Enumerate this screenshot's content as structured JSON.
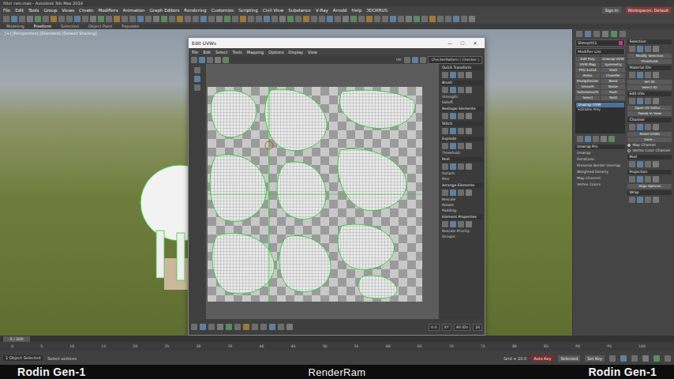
{
  "app": {
    "title": "filter ram.max - Autodesk 3ds Max 2024",
    "menus": [
      "File",
      "Edit",
      "Tools",
      "Group",
      "Views",
      "Create",
      "Modifiers",
      "Animation",
      "Graph Editors",
      "Rendering",
      "Customize",
      "Scripting",
      "Civil View",
      "Substance",
      "V-Ray",
      "Arnold",
      "Help",
      "3DOXRUS"
    ],
    "sign_in": "Sign In",
    "workspace": "Workspaces: Default",
    "ribbon_tabs": [
      {
        "label": "Modeling",
        "selected": false
      },
      {
        "label": "Freeform",
        "selected": true
      },
      {
        "label": "Selection",
        "selected": false
      },
      {
        "label": "Object Paint",
        "selected": false
      },
      {
        "label": "Populate",
        "selected": false
      }
    ]
  },
  "viewport": {
    "label": "[+] [Perspective] [Standard] [Default Shading]"
  },
  "uv_editor": {
    "title": "Edit UVWs",
    "window_buttons": [
      "—",
      "☐",
      "✕"
    ],
    "menus": [
      "File",
      "Edit",
      "Select",
      "Tools",
      "Mapping",
      "Options",
      "Display",
      "View"
    ],
    "uv_mode": "UV",
    "texture": "CheckerPattern ( Checker )",
    "sections": [
      {
        "title": "Quick Transform",
        "items": []
      },
      {
        "title": "Brush",
        "items": [
          "Strength:",
          "Falloff:"
        ]
      },
      {
        "title": "Reshape Elements",
        "items": []
      },
      {
        "title": "Stitch",
        "items": []
      },
      {
        "title": "Explode",
        "items": [
          "Threshold:"
        ]
      },
      {
        "title": "Peel",
        "items": [
          "Detach",
          "Pins"
        ]
      },
      {
        "title": "Arrange Elements",
        "items": [
          "Rescale",
          "Rotate",
          "Padding:"
        ]
      },
      {
        "title": "Element Properties",
        "items": [
          "Rescale Priority:",
          "Groups:"
        ]
      }
    ],
    "bottom_left": "0.0",
    "bottom_right": [
      "XY",
      "All IDs",
      "16"
    ]
  },
  "command_panel": {
    "object_name": "Sheep001",
    "modifier_list": "Modifier List",
    "buttons": [
      "Edit Poly",
      "Unwrap UVW",
      "UVW Map",
      "Symmetry",
      "FFD 4x4x4",
      "Shell",
      "Relax",
      "Chamfer",
      "ProOptimizer",
      "Bend",
      "Smooth",
      "Noise",
      "TurboSmooth",
      "Push",
      "Select",
      "Twist"
    ],
    "stack": [
      {
        "label": "Unwrap UVW",
        "selected": true
      },
      {
        "label": "Editable Poly",
        "selected": false
      }
    ],
    "unwrap_pro": {
      "title": "Unwrap Pro",
      "rows": [
        "Unwrap",
        "Iterations:",
        "Preserve Border Overlap",
        "Weighted Density",
        "Map Channel:",
        "Vertex Colors"
      ]
    },
    "sections": [
      {
        "title": "Selection",
        "items": [
          {
            "label": "Modify Selection",
            "kind": "button",
            "selected": false
          },
          {
            "label": "Threshold:",
            "kind": "button",
            "selected": false
          }
        ]
      },
      {
        "title": "Material IDs",
        "items": [
          {
            "label": "Set ID:",
            "kind": "button",
            "selected": false
          },
          {
            "label": "Select ID:",
            "kind": "button",
            "selected": false
          }
        ]
      },
      {
        "title": "Edit UVs",
        "items": [
          {
            "label": "Open UV Editor ...",
            "kind": "button",
            "selected": false
          },
          {
            "label": "Tweak In View",
            "kind": "button",
            "selected": false
          }
        ]
      },
      {
        "title": "Channel",
        "items": [
          {
            "label": "Reset UVWs",
            "kind": "button",
            "selected": false
          },
          {
            "label": "Save...",
            "kind": "button",
            "selected": false
          },
          {
            "label": "Map Channel",
            "kind": "radio",
            "selected": true
          },
          {
            "label": "Vertex Color Channel",
            "kind": "radio",
            "selected": false
          }
        ]
      },
      {
        "title": "Peel",
        "items": []
      },
      {
        "title": "Projection",
        "items": [
          {
            "label": "Align Options",
            "kind": "button",
            "selected": false
          }
        ]
      },
      {
        "title": "Wrap",
        "items": []
      }
    ]
  },
  "timeline": {
    "frame": "0 / 100",
    "ticks": [
      "0",
      "5",
      "10",
      "15",
      "20",
      "25",
      "30",
      "35",
      "40",
      "45",
      "50",
      "55",
      "60",
      "65",
      "70",
      "75",
      "80",
      "85",
      "90",
      "95",
      "100"
    ]
  },
  "status": {
    "selection": "1 Object Selected",
    "prompt": "Select vertices",
    "grid": "Grid = 10.0",
    "auto_key": "Auto Key",
    "filter": "Selected",
    "set_key": "Set Key"
  },
  "caption": {
    "left": "Rodin Gen-1",
    "center": "RenderRam",
    "right": "Rodin Gen-1"
  }
}
